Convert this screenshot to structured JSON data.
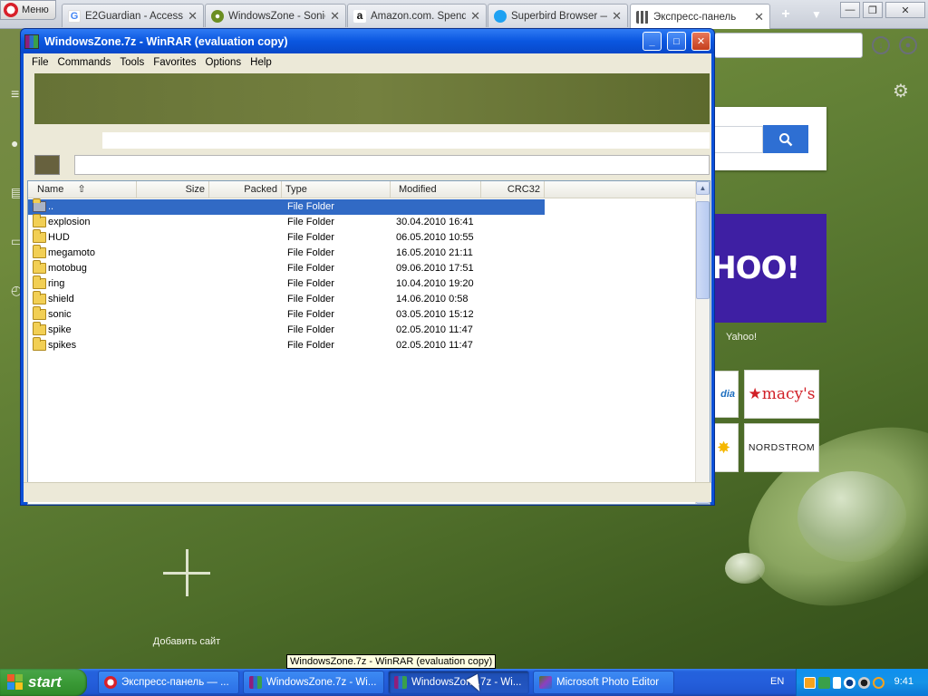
{
  "browser": {
    "menu_label": "Меню",
    "tabs": [
      {
        "title": "E2Guardian - Access",
        "icon_color": "#4285f4",
        "icon": "google-icon"
      },
      {
        "title": "WindowsZone - Sonic",
        "icon_color": "#6b8e23",
        "icon": "windowszone-icon"
      },
      {
        "title": "Amazon.com. Spend",
        "icon_color": "#111111",
        "icon": "amazon-icon"
      },
      {
        "title": "Superbird Browser —",
        "icon_color": "#1ea1f2",
        "icon": "superbird-icon"
      },
      {
        "title": "Экспресс-панель",
        "icon_color": "#555555",
        "icon": "grid-icon"
      }
    ],
    "add_tab": "+",
    "tab_menu": "▼"
  },
  "express": {
    "yahoo_text": "AHOO!",
    "yahoo_label": "Yahoo!",
    "tiles": {
      "media": "dia",
      "macys": "★macy's",
      "walmart": "✸",
      "nordstrom": "NORDSTROM"
    },
    "add_site_label": "Добавить сайт"
  },
  "winrar": {
    "title": "WindowsZone.7z - WinRAR (evaluation copy)",
    "menu": [
      "File",
      "Commands",
      "Tools",
      "Favorites",
      "Options",
      "Help"
    ],
    "columns": {
      "name": "Name",
      "size": "Size",
      "packed": "Packed",
      "type": "Type",
      "modified": "Modified",
      "crc": "CRC32"
    },
    "rows": [
      {
        "name": "..",
        "type": "File Folder",
        "modified": ""
      },
      {
        "name": "explosion",
        "type": "File Folder",
        "modified": "30.04.2010 16:41"
      },
      {
        "name": "HUD",
        "type": "File Folder",
        "modified": "06.05.2010 10:55"
      },
      {
        "name": "megamoto",
        "type": "File Folder",
        "modified": "16.05.2010 21:11"
      },
      {
        "name": "motobug",
        "type": "File Folder",
        "modified": "09.06.2010 17:51"
      },
      {
        "name": "ring",
        "type": "File Folder",
        "modified": "10.04.2010 19:20"
      },
      {
        "name": "shield",
        "type": "File Folder",
        "modified": "14.06.2010 0:58"
      },
      {
        "name": "sonic",
        "type": "File Folder",
        "modified": "03.05.2010 15:12"
      },
      {
        "name": "spike",
        "type": "File Folder",
        "modified": "02.05.2010 11:47"
      },
      {
        "name": "spikes",
        "type": "File Folder",
        "modified": "02.05.2010 11:47"
      }
    ]
  },
  "tooltip": "WindowsZone.7z - WinRAR (evaluation copy)",
  "taskbar": {
    "start": "start",
    "tasks": [
      {
        "label": "Экспресс-панель — ...",
        "icon_color": "#d8202a"
      },
      {
        "label": "WindowsZone.7z - Wi...",
        "icon_color": "#8e1f7c"
      },
      {
        "label": "WindowsZone.7z - Wi...",
        "icon_color": "#8e1f7c"
      },
      {
        "label": "Microsoft Photo Editor",
        "icon_color": "#4a7a2a"
      }
    ],
    "language": "EN",
    "clock": "9:41"
  }
}
